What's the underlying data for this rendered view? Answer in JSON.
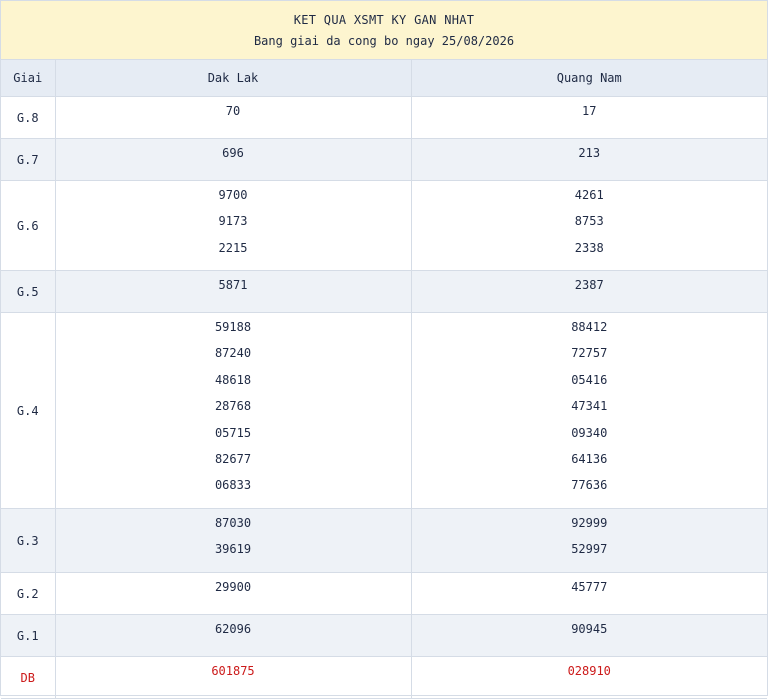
{
  "header": {
    "title": "KET QUA XSMT KY GAN NHAT",
    "subtitle": "Bang giai da cong bo ngay 25/08/2026"
  },
  "table": {
    "col_prize": "Giai",
    "col_a": "Dak Lak",
    "col_b": "Quang Nam",
    "rows": [
      {
        "prize": "G.8",
        "a": [
          "70"
        ],
        "b": [
          "17"
        ]
      },
      {
        "prize": "G.7",
        "a": [
          "696"
        ],
        "b": [
          "213"
        ]
      },
      {
        "prize": "G.6",
        "a": [
          "9700",
          "9173",
          "2215"
        ],
        "b": [
          "4261",
          "8753",
          "2338"
        ]
      },
      {
        "prize": "G.5",
        "a": [
          "5871"
        ],
        "b": [
          "2387"
        ]
      },
      {
        "prize": "G.4",
        "a": [
          "59188",
          "87240",
          "48618",
          "28768",
          "05715",
          "82677",
          "06833"
        ],
        "b": [
          "88412",
          "72757",
          "05416",
          "47341",
          "09340",
          "64136",
          "77636"
        ]
      },
      {
        "prize": "G.3",
        "a": [
          "87030",
          "39619"
        ],
        "b": [
          "92999",
          "52997"
        ]
      },
      {
        "prize": "G.2",
        "a": [
          "29900"
        ],
        "b": [
          "45777"
        ]
      },
      {
        "prize": "G.1",
        "a": [
          "62096"
        ],
        "b": [
          "90945"
        ]
      },
      {
        "prize": "DB",
        "a": [
          "601875"
        ],
        "b": [
          "028910"
        ]
      }
    ]
  },
  "colors": {
    "highlight": "#cc1a1a",
    "header_bg": "#fdf5cf",
    "stripe": "#eef2f7"
  }
}
